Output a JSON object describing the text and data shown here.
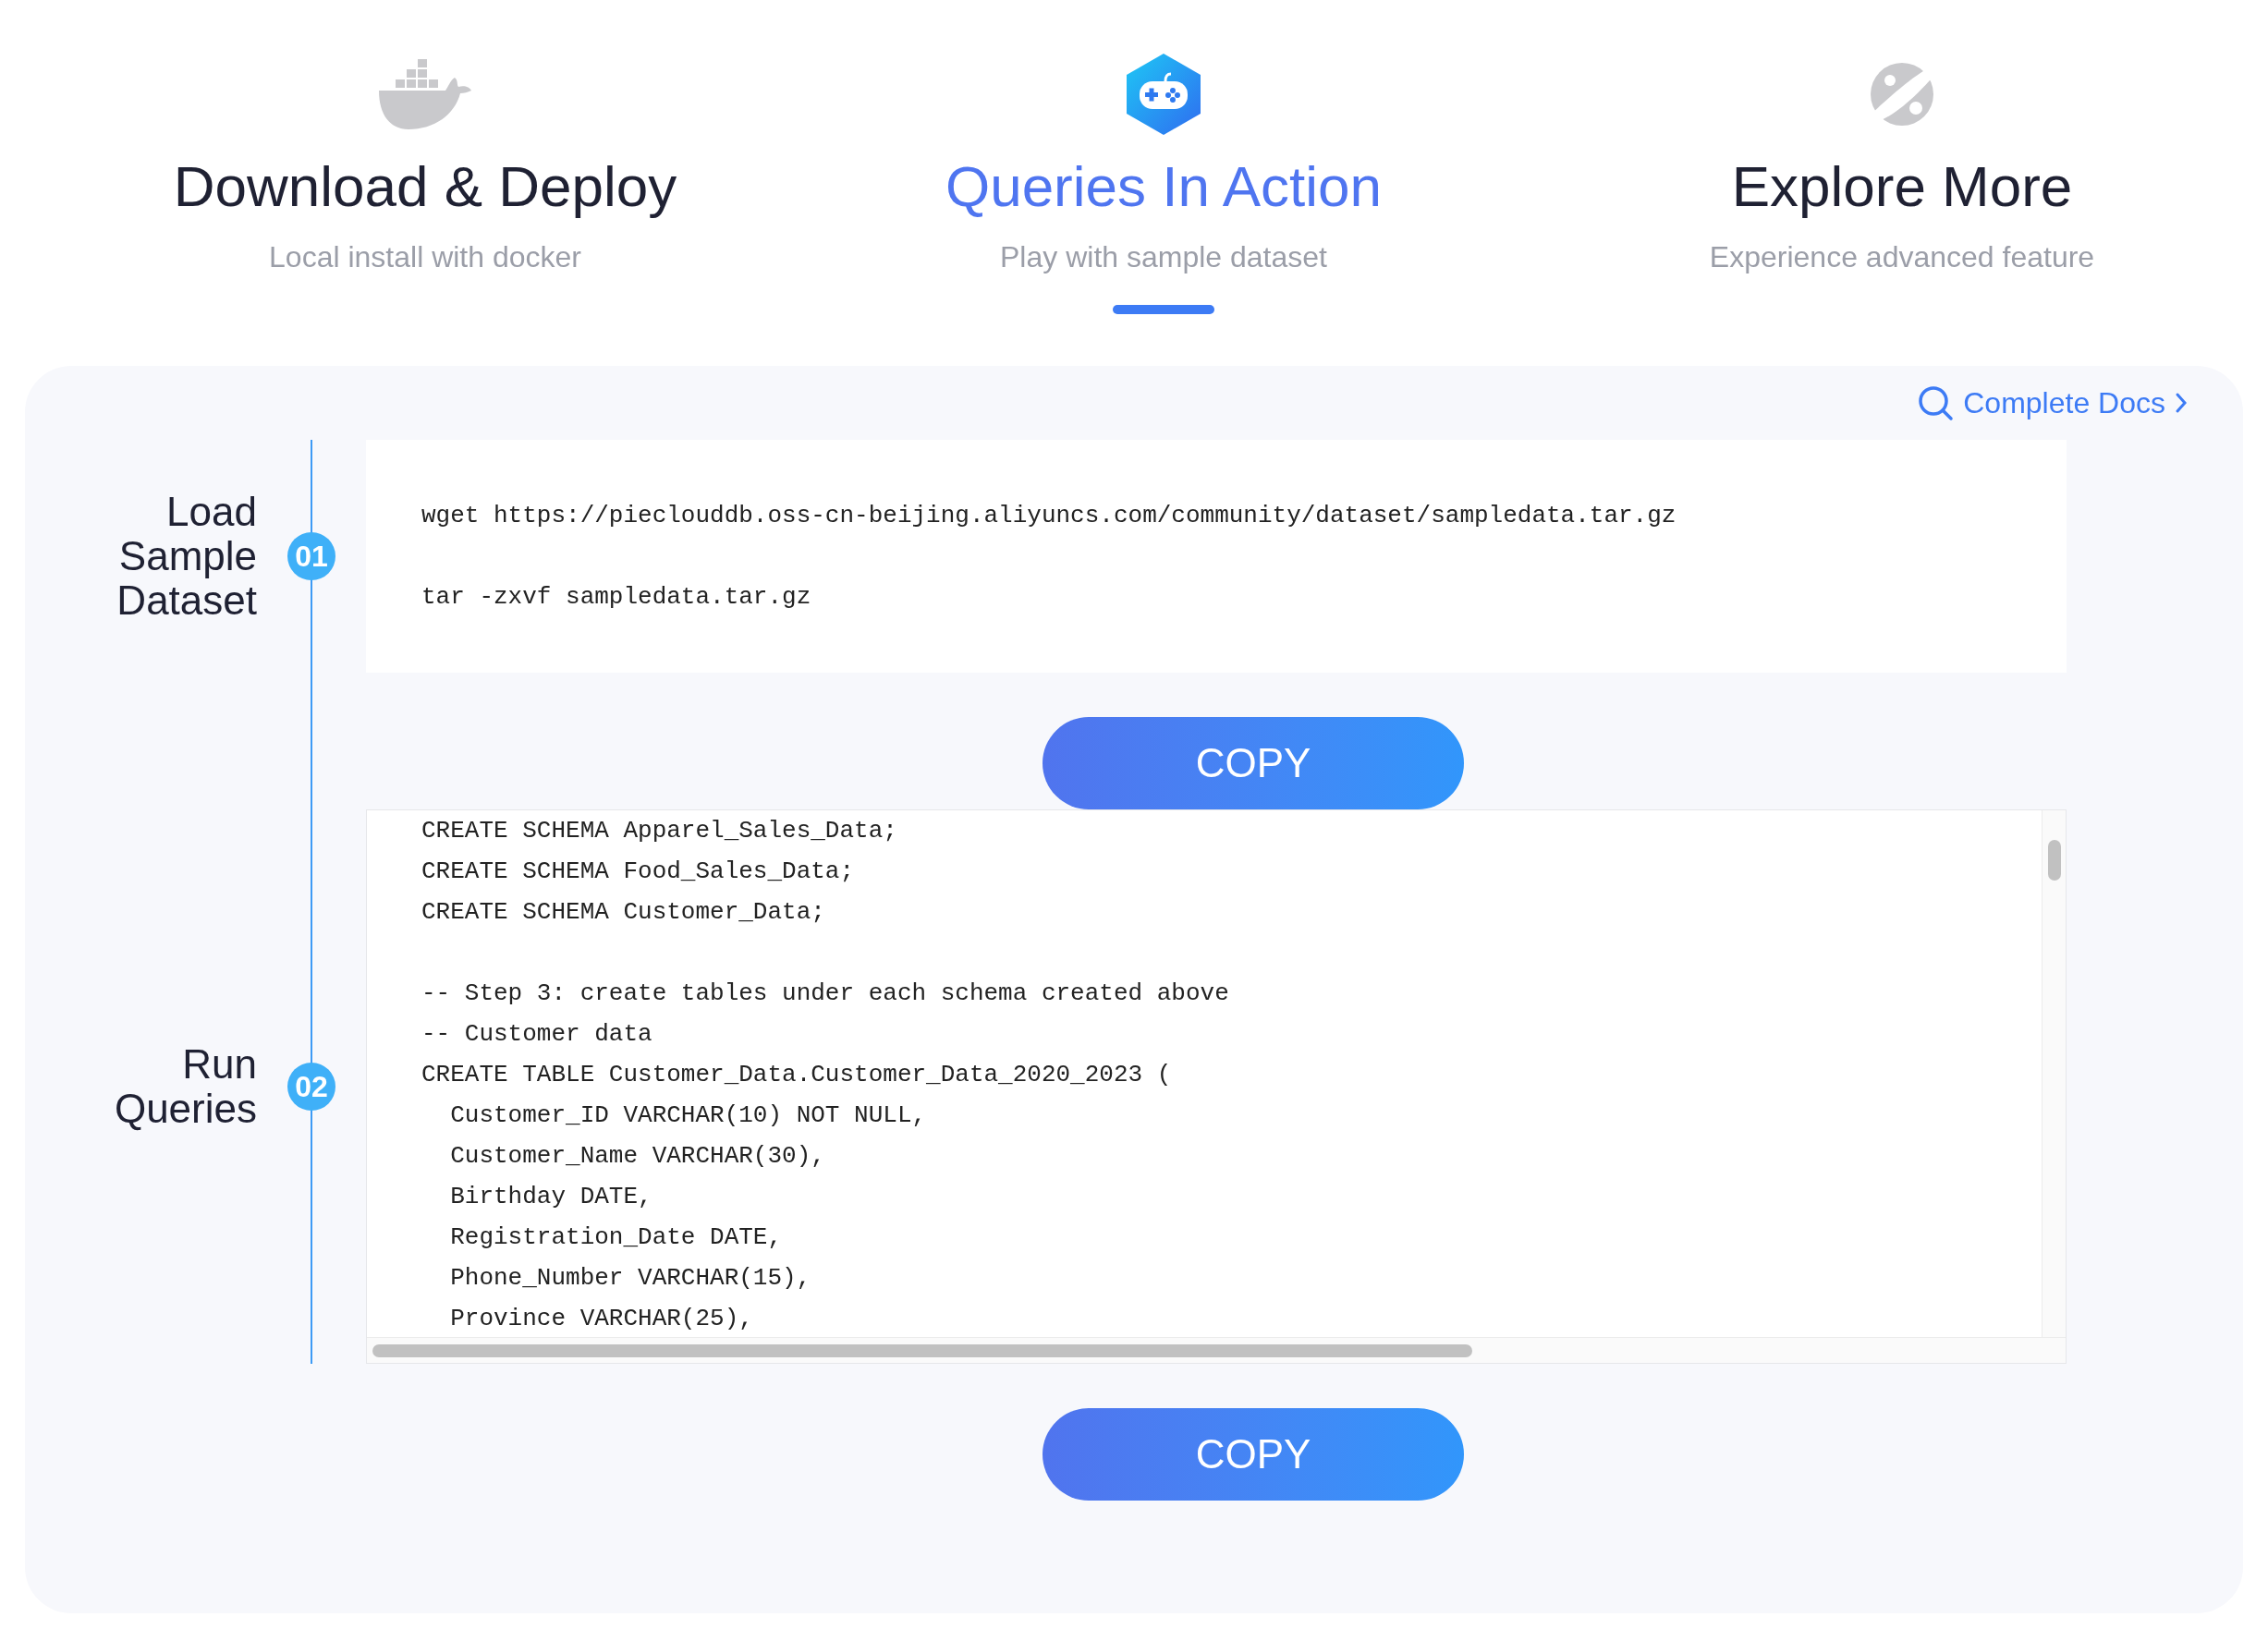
{
  "tabs": [
    {
      "kind": "whale",
      "title": "Download & Deploy",
      "subtitle": "Local install with docker",
      "selected": false
    },
    {
      "kind": "gamepad",
      "title": "Queries In Action",
      "subtitle": "Play with sample dataset",
      "selected": true
    },
    {
      "kind": "planet",
      "title": "Explore More",
      "subtitle": "Experience advanced feature",
      "selected": false
    }
  ],
  "docs_link": "Complete Docs",
  "steps": [
    {
      "label": "Load Sample Dataset",
      "number": "01",
      "kind": "plain",
      "code": "wget https://pieclouddb.oss-cn-beijing.aliyuncs.com/community/dataset/sampledata.tar.gz\n\ntar -zxvf sampledata.tar.gz",
      "button": "COPY"
    },
    {
      "label": "Run Queries",
      "number": "02",
      "kind": "scroll",
      "code": "CREATE SCHEMA Apparel_Sales_Data;\nCREATE SCHEMA Food_Sales_Data;\nCREATE SCHEMA Customer_Data;\n\n-- Step 3: create tables under each schema created above\n-- Customer data\nCREATE TABLE Customer_Data.Customer_Data_2020_2023 (\n  Customer_ID VARCHAR(10) NOT NULL,\n  Customer_Name VARCHAR(30),\n  Birthday DATE,\n  Registration_Date DATE,\n  Phone_Number VARCHAR(15),\n  Province VARCHAR(25),",
      "button": "COPY"
    }
  ]
}
